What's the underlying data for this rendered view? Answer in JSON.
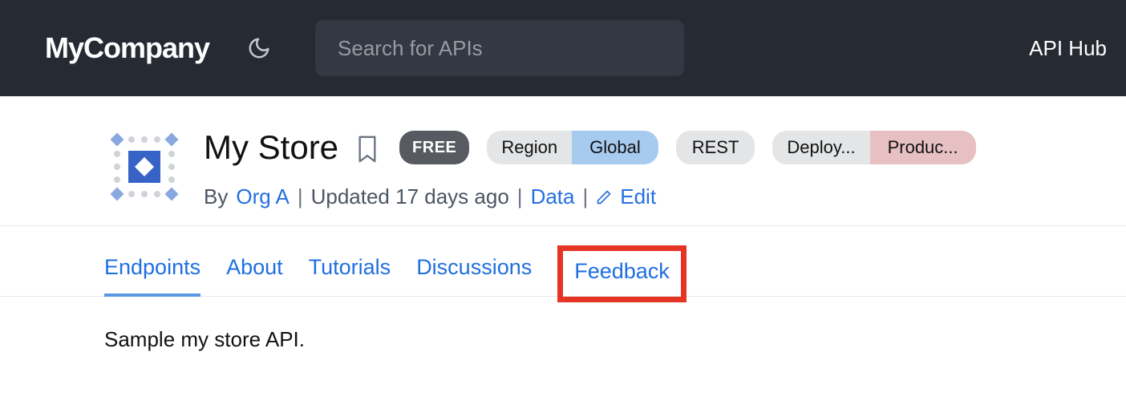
{
  "header": {
    "brand": "MyCompany",
    "search_placeholder": "Search for APIs",
    "hub_link": "API Hub"
  },
  "api": {
    "title": "My Store",
    "badge_free": "FREE",
    "chip_region_key": "Region",
    "chip_region_value": "Global",
    "chip_rest": "REST",
    "chip_deploy_key": "Deploy...",
    "chip_deploy_value": "Produc...",
    "byline_prefix": "By",
    "org": "Org A",
    "updated": "Updated 17 days ago",
    "category": "Data",
    "edit": "Edit"
  },
  "tabs": {
    "endpoints": "Endpoints",
    "about": "About",
    "tutorials": "Tutorials",
    "discussions": "Discussions",
    "feedback": "Feedback"
  },
  "content": {
    "description": "Sample my store API."
  }
}
